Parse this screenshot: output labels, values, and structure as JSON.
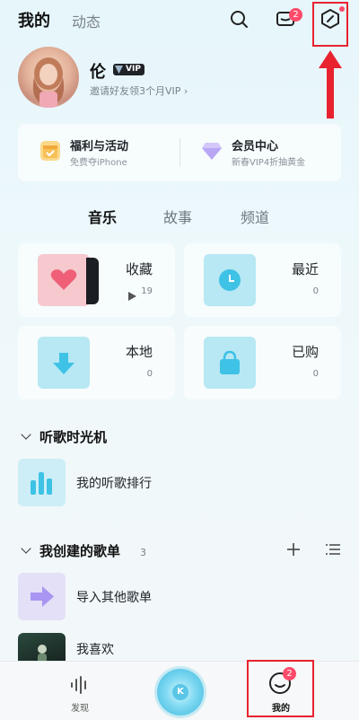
{
  "header": {
    "tab_mine": "我的",
    "tab_feed": "动态",
    "message_badge": "2",
    "icons": [
      "search-icon",
      "mail-icon",
      "compass-icon"
    ]
  },
  "profile": {
    "name": "伦",
    "vip_label": "VIP",
    "invite_text": "邀请好友领3个月VIP ›"
  },
  "benefits": [
    {
      "title": "福利与活动",
      "subtitle": "免费夺iPhone",
      "icon": "gift-calendar-icon"
    },
    {
      "title": "会员中心",
      "subtitle": "新春VIP4折抽黄金",
      "icon": "diamond-icon"
    }
  ],
  "segments": [
    "音乐",
    "故事",
    "频道"
  ],
  "tiles": [
    {
      "label": "收藏",
      "count": "19",
      "icon": "heart-icon"
    },
    {
      "label": "最近",
      "count": "0",
      "icon": "clock-icon"
    },
    {
      "label": "本地",
      "count": "0",
      "icon": "download-icon"
    },
    {
      "label": "已购",
      "count": "0",
      "icon": "bag-icon"
    }
  ],
  "time_machine": {
    "title": "听歌时光机",
    "item_label": "我的听歌排行"
  },
  "playlists": {
    "title": "我创建的歌单",
    "count": "3",
    "items": [
      "导入其他歌单",
      "我喜欢"
    ]
  },
  "bottom_nav": {
    "discover": "发现",
    "center_icon": "K",
    "mine": "我的",
    "mine_badge": "2"
  },
  "colors": {
    "accent_red": "#e8232f",
    "badge": "#ff4a6a",
    "tile_pink": "#f6c9cf",
    "tile_blue": "#aee6f2"
  }
}
